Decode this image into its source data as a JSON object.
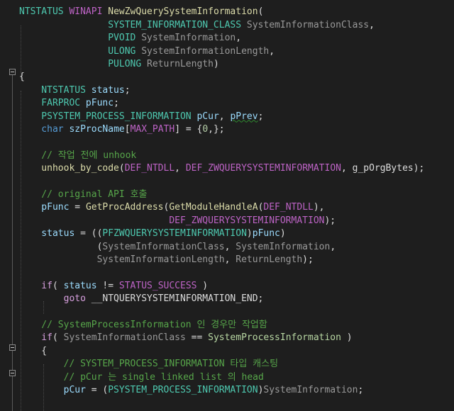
{
  "editor": {
    "language": "C++",
    "colors": {
      "background": "#1e1e1e",
      "keyword": "#569cd6",
      "type": "#4ec9b0",
      "function": "#dcdcaa",
      "macro": "#bd63c5",
      "parameter": "#9a9a9a",
      "local_variable": "#9cdcfe",
      "comment": "#57a64a",
      "enum_member": "#b8d7a3",
      "control_keyword": "#d8a0df",
      "number": "#b5cea8"
    },
    "lines": [
      {
        "tokens": [
          {
            "t": "NTSTATUS",
            "c": "type"
          },
          {
            "t": " ",
            "c": "plain"
          },
          {
            "t": "WINAPI",
            "c": "macro"
          },
          {
            "t": " ",
            "c": "plain"
          },
          {
            "t": "NewZwQuerySystemInformation",
            "c": "fn"
          },
          {
            "t": "(",
            "c": "plain"
          }
        ]
      },
      {
        "tokens": [
          {
            "t": "                SYSTEM_INFORMATION_CLASS",
            "c": "type"
          },
          {
            "t": " ",
            "c": "plain"
          },
          {
            "t": "SystemInformationClass",
            "c": "param"
          },
          {
            "t": ",",
            "c": "plain"
          }
        ]
      },
      {
        "tokens": [
          {
            "t": "                PVOID",
            "c": "type"
          },
          {
            "t": " ",
            "c": "plain"
          },
          {
            "t": "SystemInformation",
            "c": "param"
          },
          {
            "t": ",",
            "c": "plain"
          }
        ]
      },
      {
        "tokens": [
          {
            "t": "                ULONG",
            "c": "type"
          },
          {
            "t": " ",
            "c": "plain"
          },
          {
            "t": "SystemInformationLength",
            "c": "param"
          },
          {
            "t": ",",
            "c": "plain"
          }
        ]
      },
      {
        "tokens": [
          {
            "t": "                PULONG",
            "c": "type"
          },
          {
            "t": " ",
            "c": "plain"
          },
          {
            "t": "ReturnLength",
            "c": "param"
          },
          {
            "t": ")",
            "c": "plain"
          }
        ]
      },
      {
        "tokens": [
          {
            "t": "{",
            "c": "plain"
          }
        ]
      },
      {
        "tokens": [
          {
            "t": "    NTSTATUS",
            "c": "type"
          },
          {
            "t": " ",
            "c": "plain"
          },
          {
            "t": "status",
            "c": "local"
          },
          {
            "t": ";",
            "c": "plain"
          }
        ]
      },
      {
        "tokens": [
          {
            "t": "    FARPROC",
            "c": "type"
          },
          {
            "t": " ",
            "c": "plain"
          },
          {
            "t": "pFunc",
            "c": "local"
          },
          {
            "t": ";",
            "c": "plain"
          }
        ]
      },
      {
        "tokens": [
          {
            "t": "    PSYSTEM_PROCESS_INFORMATION",
            "c": "type"
          },
          {
            "t": " ",
            "c": "plain"
          },
          {
            "t": "pCur",
            "c": "local"
          },
          {
            "t": ", ",
            "c": "plain"
          },
          {
            "t": "pPrev",
            "c": "local",
            "u": true
          },
          {
            "t": ";",
            "c": "plain"
          }
        ]
      },
      {
        "tokens": [
          {
            "t": "    char",
            "c": "kw"
          },
          {
            "t": " ",
            "c": "plain"
          },
          {
            "t": "szProcName",
            "c": "local"
          },
          {
            "t": "[",
            "c": "plain"
          },
          {
            "t": "MAX_PATH",
            "c": "macro"
          },
          {
            "t": "] = {",
            "c": "plain"
          },
          {
            "t": "0",
            "c": "num"
          },
          {
            "t": ",};",
            "c": "plain"
          }
        ]
      },
      {
        "tokens": []
      },
      {
        "tokens": [
          {
            "t": "    // 작업 전에 unhook",
            "c": "cm"
          }
        ]
      },
      {
        "tokens": [
          {
            "t": "    unhook_by_code",
            "c": "fn"
          },
          {
            "t": "(",
            "c": "plain"
          },
          {
            "t": "DEF_NTDLL",
            "c": "macro"
          },
          {
            "t": ", ",
            "c": "plain"
          },
          {
            "t": "DEF_ZWQUERYSYSTEMINFORMATION",
            "c": "macro"
          },
          {
            "t": ", ",
            "c": "plain"
          },
          {
            "t": "g_pOrgBytes",
            "c": "plain"
          },
          {
            "t": ");",
            "c": "plain"
          }
        ]
      },
      {
        "tokens": []
      },
      {
        "tokens": [
          {
            "t": "    // original API 호출",
            "c": "cm"
          }
        ]
      },
      {
        "tokens": [
          {
            "t": "    pFunc",
            "c": "local"
          },
          {
            "t": " = ",
            "c": "plain"
          },
          {
            "t": "GetProcAddress",
            "c": "fn"
          },
          {
            "t": "(",
            "c": "plain"
          },
          {
            "t": "GetModuleHandleA",
            "c": "fn"
          },
          {
            "t": "(",
            "c": "plain"
          },
          {
            "t": "DEF_NTDLL",
            "c": "macro"
          },
          {
            "t": "),",
            "c": "plain"
          }
        ]
      },
      {
        "tokens": [
          {
            "t": "                           DEF_ZWQUERYSYSTEMINFORMATION",
            "c": "macro"
          },
          {
            "t": ");",
            "c": "plain"
          }
        ]
      },
      {
        "tokens": [
          {
            "t": "    status",
            "c": "local"
          },
          {
            "t": " = ((",
            "c": "plain"
          },
          {
            "t": "PFZWQUERYSYSTEMINFORMATION",
            "c": "type"
          },
          {
            "t": ")",
            "c": "plain"
          },
          {
            "t": "pFunc",
            "c": "local"
          },
          {
            "t": ")",
            "c": "plain"
          }
        ]
      },
      {
        "tokens": [
          {
            "t": "              (",
            "c": "plain"
          },
          {
            "t": "SystemInformationClass",
            "c": "param"
          },
          {
            "t": ", ",
            "c": "plain"
          },
          {
            "t": "SystemInformation",
            "c": "param"
          },
          {
            "t": ",",
            "c": "plain"
          }
        ]
      },
      {
        "tokens": [
          {
            "t": "              SystemInformationLength",
            "c": "param"
          },
          {
            "t": ", ",
            "c": "plain"
          },
          {
            "t": "ReturnLength",
            "c": "param"
          },
          {
            "t": ");",
            "c": "plain"
          }
        ]
      },
      {
        "tokens": []
      },
      {
        "tokens": [
          {
            "t": "    if",
            "c": "ctl"
          },
          {
            "t": "( ",
            "c": "plain"
          },
          {
            "t": "status",
            "c": "local"
          },
          {
            "t": " != ",
            "c": "plain"
          },
          {
            "t": "STATUS_SUCCESS",
            "c": "macro"
          },
          {
            "t": " )",
            "c": "plain"
          }
        ]
      },
      {
        "tokens": [
          {
            "t": "        goto",
            "c": "ctl"
          },
          {
            "t": " __NTQUERYSYSTEMINFORMATION_END;",
            "c": "plain"
          }
        ]
      },
      {
        "tokens": []
      },
      {
        "tokens": [
          {
            "t": "    // SystemProcessInformation 인 경우만 작업함",
            "c": "cm"
          }
        ]
      },
      {
        "tokens": [
          {
            "t": "    if",
            "c": "ctl"
          },
          {
            "t": "( ",
            "c": "plain"
          },
          {
            "t": "SystemInformationClass",
            "c": "param"
          },
          {
            "t": " == ",
            "c": "plain"
          },
          {
            "t": "SystemProcessInformation",
            "c": "enum"
          },
          {
            "t": " )",
            "c": "plain"
          }
        ]
      },
      {
        "tokens": [
          {
            "t": "    {",
            "c": "plain"
          }
        ]
      },
      {
        "tokens": [
          {
            "t": "        // SYSTEM_PROCESS_INFORMATION 타입 캐스팅",
            "c": "cm"
          }
        ]
      },
      {
        "tokens": [
          {
            "t": "        // pCur 는 single linked list 의 head",
            "c": "cm"
          }
        ]
      },
      {
        "tokens": [
          {
            "t": "        pCur",
            "c": "local"
          },
          {
            "t": " = (",
            "c": "plain"
          },
          {
            "t": "PSYSTEM_PROCESS_INFORMATION",
            "c": "type"
          },
          {
            "t": ")",
            "c": "plain"
          },
          {
            "t": "SystemInformation",
            "c": "param"
          },
          {
            "t": ";",
            "c": "plain"
          }
        ]
      },
      {
        "tokens": []
      }
    ]
  }
}
